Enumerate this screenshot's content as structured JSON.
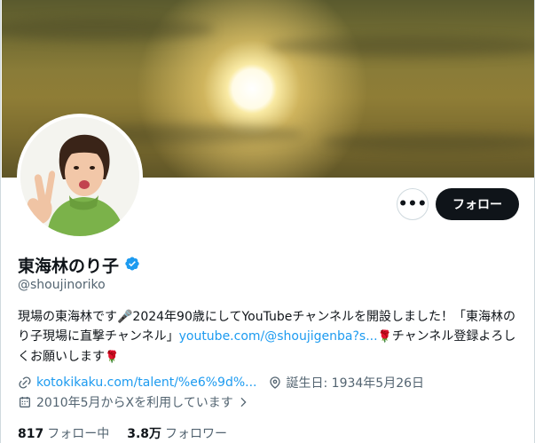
{
  "profile": {
    "name": "東海林のり子",
    "handle": "@shoujinoriko",
    "bio_part1": "現場の東海林です🎤2024年90歳にしてYouTubeチャンネルを開設しました！「東海林のり子現場に直撃チャンネル」",
    "bio_link": "youtube.com/@shoujigenba?s...",
    "bio_rose1": "🌹",
    "bio_part2": "チャンネル登録よろしくお願いします",
    "bio_rose2": "🌹",
    "website": "kotokikaku.com/talent/%e6%9d%...",
    "birthday": "誕生日: 1934年5月26日",
    "joined": "2010年5月からXを利用しています",
    "following_count": "817",
    "following_label": "フォロー中",
    "followers_count": "3.8万",
    "followers_label": "フォロワー"
  },
  "actions": {
    "more_label": "•••",
    "follow_label": "フォロー"
  },
  "colors": {
    "accent": "#1d9bf0",
    "text": "#0f1419",
    "muted": "#536471",
    "button_dark": "#0f1419"
  },
  "icons": [
    "verified-badge-icon",
    "link-icon",
    "location-icon",
    "calendar-icon",
    "chevron-right-icon",
    "more-icon"
  ]
}
